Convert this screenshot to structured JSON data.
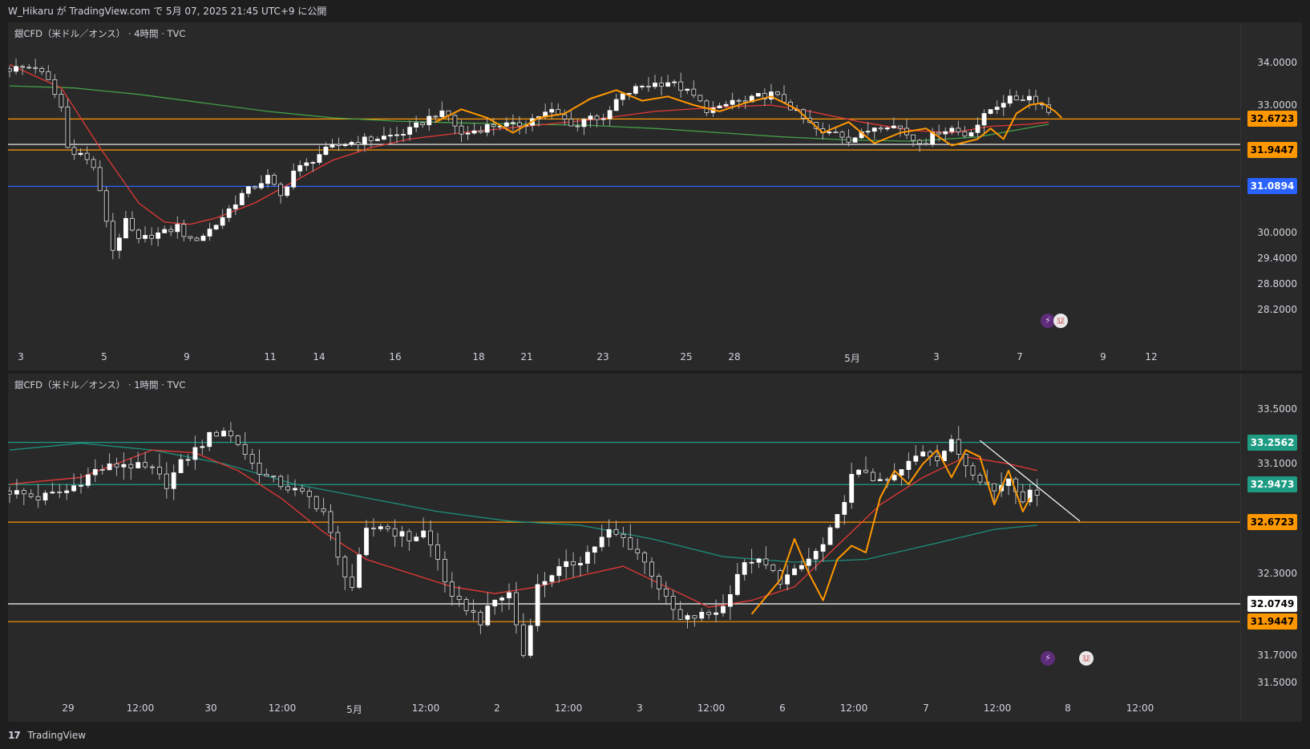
{
  "header": {
    "text": "W_Hikaru が TradingView.com で 5月 07, 2025 21:45 UTC+9 に公開"
  },
  "footer": {
    "brand": "TradingView",
    "logo_icon": "tradingview-logo-icon"
  },
  "colors": {
    "bg": "#292929",
    "up": "#ffffff",
    "down": "#1f1f1f",
    "wick": "#b2b5be",
    "ma_red": "#e53935",
    "ma_green": "#43a047",
    "ma_teal": "#1d8f7a",
    "zigzag": "#ff9800",
    "orange_level": "#ff9800",
    "blue_level": "#2962ff",
    "teal_level": "#1e9c83",
    "white_level": "#ffffff"
  },
  "chart_data": [
    {
      "type": "candlestick",
      "title": "銀CFD（米ドル／オンス） · 4時間 · TVC",
      "y_ticks": [
        "34.0000",
        "33.0000",
        "30.0000",
        "29.4000",
        "28.8000",
        "28.2000"
      ],
      "ylim": [
        27.5,
        34.6
      ],
      "x_ticks": [
        "3",
        "5",
        "9",
        "11",
        "14",
        "16",
        "18",
        "21",
        "23",
        "25",
        "28",
        "5月",
        "3",
        "7",
        "9",
        "12"
      ],
      "price_tags": [
        {
          "value": 32.6723,
          "label": "32.6723",
          "color": "orange"
        },
        {
          "value": 31.9447,
          "label": "31.9447",
          "color": "orange"
        },
        {
          "value": 31.0894,
          "label": "31.0894",
          "color": "blue"
        },
        {
          "value": 32.0749,
          "label": "32.0749",
          "color": "white",
          "hidden": true
        }
      ],
      "levels": [
        32.6723,
        32.0749,
        31.9447,
        31.0894
      ],
      "close_path": [
        [
          0,
          33.85
        ],
        [
          4,
          33.9
        ],
        [
          6,
          33.55
        ],
        [
          8,
          32.95
        ],
        [
          9,
          32.0
        ],
        [
          11,
          31.85
        ],
        [
          13,
          31.55
        ],
        [
          15,
          30.3
        ],
        [
          16,
          29.6
        ],
        [
          18,
          30.25
        ],
        [
          20,
          29.8
        ],
        [
          22,
          29.95
        ],
        [
          24,
          30.0
        ],
        [
          26,
          30.15
        ],
        [
          28,
          29.8
        ],
        [
          30,
          29.95
        ],
        [
          32,
          30.2
        ],
        [
          34,
          30.55
        ],
        [
          36,
          30.9
        ],
        [
          38,
          31.1
        ],
        [
          40,
          31.3
        ],
        [
          42,
          30.85
        ],
        [
          44,
          31.45
        ],
        [
          46,
          31.6
        ],
        [
          48,
          31.85
        ],
        [
          50,
          32.0
        ],
        [
          52,
          32.1
        ],
        [
          54,
          32.15
        ],
        [
          56,
          32.2
        ],
        [
          58,
          32.25
        ],
        [
          60,
          32.3
        ],
        [
          62,
          32.4
        ],
        [
          64,
          32.6
        ],
        [
          66,
          32.8
        ],
        [
          68,
          32.75
        ],
        [
          70,
          32.3
        ],
        [
          72,
          32.4
        ],
        [
          74,
          32.5
        ],
        [
          76,
          32.55
        ],
        [
          78,
          32.5
        ],
        [
          80,
          32.6
        ],
        [
          82,
          32.75
        ],
        [
          84,
          32.85
        ],
        [
          86,
          32.65
        ],
        [
          88,
          32.5
        ],
        [
          90,
          32.8
        ],
        [
          92,
          32.6
        ],
        [
          94,
          33.1
        ],
        [
          96,
          33.3
        ],
        [
          98,
          33.45
        ],
        [
          100,
          33.5
        ],
        [
          102,
          33.55
        ],
        [
          104,
          33.4
        ],
        [
          106,
          33.2
        ],
        [
          108,
          32.9
        ],
        [
          110,
          32.9
        ],
        [
          112,
          33.1
        ],
        [
          114,
          33.05
        ],
        [
          116,
          33.2
        ],
        [
          118,
          33.25
        ],
        [
          120,
          33.1
        ],
        [
          122,
          32.8
        ],
        [
          124,
          32.55
        ],
        [
          126,
          32.3
        ],
        [
          128,
          32.4
        ],
        [
          130,
          32.2
        ],
        [
          132,
          32.3
        ],
        [
          134,
          32.5
        ],
        [
          136,
          32.55
        ],
        [
          138,
          32.45
        ],
        [
          140,
          32.2
        ],
        [
          142,
          32.15
        ],
        [
          144,
          32.4
        ],
        [
          146,
          32.45
        ],
        [
          148,
          32.3
        ],
        [
          150,
          32.55
        ],
        [
          152,
          32.9
        ],
        [
          154,
          33.1
        ],
        [
          156,
          33.15
        ],
        [
          158,
          33.2
        ],
        [
          160,
          33.0
        ],
        [
          161,
          32.85
        ]
      ],
      "ma_fast": [
        [
          0,
          33.95
        ],
        [
          8,
          33.4
        ],
        [
          14,
          32.0
        ],
        [
          20,
          30.7
        ],
        [
          24,
          30.25
        ],
        [
          28,
          30.2
        ],
        [
          32,
          30.35
        ],
        [
          38,
          30.7
        ],
        [
          44,
          31.2
        ],
        [
          50,
          31.7
        ],
        [
          56,
          32.0
        ],
        [
          62,
          32.2
        ],
        [
          70,
          32.35
        ],
        [
          80,
          32.5
        ],
        [
          90,
          32.65
        ],
        [
          100,
          32.85
        ],
        [
          110,
          32.95
        ],
        [
          118,
          33.0
        ],
        [
          124,
          32.85
        ],
        [
          132,
          32.6
        ],
        [
          140,
          32.4
        ],
        [
          146,
          32.35
        ],
        [
          152,
          32.5
        ],
        [
          158,
          32.55
        ],
        [
          161,
          32.6
        ]
      ],
      "ma_slow": [
        [
          0,
          33.45
        ],
        [
          10,
          33.4
        ],
        [
          20,
          33.25
        ],
        [
          30,
          33.05
        ],
        [
          40,
          32.85
        ],
        [
          50,
          32.7
        ],
        [
          60,
          32.62
        ],
        [
          70,
          32.58
        ],
        [
          80,
          32.55
        ],
        [
          90,
          32.52
        ],
        [
          100,
          32.45
        ],
        [
          110,
          32.35
        ],
        [
          120,
          32.25
        ],
        [
          130,
          32.18
        ],
        [
          140,
          32.15
        ],
        [
          150,
          32.25
        ],
        [
          161,
          32.55
        ]
      ],
      "zigzag": [
        [
          66,
          32.6
        ],
        [
          70,
          32.9
        ],
        [
          74,
          32.7
        ],
        [
          78,
          32.35
        ],
        [
          82,
          32.7
        ],
        [
          86,
          32.8
        ],
        [
          90,
          33.15
        ],
        [
          94,
          33.35
        ],
        [
          98,
          33.1
        ],
        [
          102,
          33.2
        ],
        [
          106,
          33.0
        ],
        [
          110,
          32.85
        ],
        [
          114,
          33.05
        ],
        [
          118,
          33.2
        ],
        [
          122,
          32.9
        ],
        [
          126,
          32.35
        ],
        [
          130,
          32.6
        ],
        [
          134,
          32.1
        ],
        [
          138,
          32.35
        ],
        [
          142,
          32.45
        ],
        [
          146,
          32.05
        ],
        [
          150,
          32.2
        ],
        [
          152,
          32.45
        ],
        [
          154,
          32.2
        ],
        [
          156,
          32.8
        ],
        [
          158,
          33.0
        ],
        [
          160,
          33.05
        ],
        [
          162,
          32.85
        ],
        [
          163,
          32.7
        ]
      ]
    },
    {
      "type": "candlestick",
      "title": "銀CFD（米ドル／オンス） · 1時間 · TVC",
      "y_ticks": [
        "33.5000",
        "33.1000",
        "32.3000",
        "31.7000",
        "31.5000"
      ],
      "ylim": [
        31.4,
        33.7
      ],
      "x_ticks": [
        "29",
        "12:00",
        "30",
        "12:00",
        "5月",
        "12:00",
        "2",
        "12:00",
        "3",
        "12:00",
        "6",
        "12:00",
        "7",
        "12:00",
        "8",
        "12:00"
      ],
      "price_tags": [
        {
          "value": 33.2562,
          "label": "33.2562",
          "color": "teal"
        },
        {
          "value": 32.9473,
          "label": "32.9473",
          "color": "teal"
        },
        {
          "value": 32.6723,
          "label": "32.6723",
          "color": "orange"
        },
        {
          "value": 32.0749,
          "label": "32.0749",
          "color": "white"
        },
        {
          "value": 31.9447,
          "label": "31.9447",
          "color": "orange"
        }
      ],
      "levels": [
        33.2562,
        32.9473,
        32.6723,
        32.0749,
        31.9447
      ],
      "close_path": [
        [
          0,
          32.9
        ],
        [
          4,
          32.85
        ],
        [
          8,
          32.9
        ],
        [
          12,
          33.05
        ],
        [
          16,
          33.1
        ],
        [
          20,
          33.05
        ],
        [
          22,
          32.95
        ],
        [
          24,
          33.1
        ],
        [
          26,
          33.2
        ],
        [
          28,
          33.3
        ],
        [
          30,
          33.35
        ],
        [
          32,
          33.25
        ],
        [
          34,
          33.1
        ],
        [
          36,
          33.0
        ],
        [
          38,
          32.95
        ],
        [
          40,
          32.9
        ],
        [
          42,
          32.85
        ],
        [
          44,
          32.75
        ],
        [
          46,
          32.4
        ],
        [
          48,
          32.2
        ],
        [
          50,
          32.6
        ],
        [
          52,
          32.65
        ],
        [
          54,
          32.6
        ],
        [
          56,
          32.55
        ],
        [
          58,
          32.6
        ],
        [
          60,
          32.4
        ],
        [
          62,
          32.1
        ],
        [
          64,
          32.05
        ],
        [
          66,
          31.95
        ],
        [
          68,
          32.1
        ],
        [
          70,
          32.15
        ],
        [
          72,
          31.7
        ],
        [
          74,
          32.2
        ],
        [
          76,
          32.3
        ],
        [
          78,
          32.35
        ],
        [
          80,
          32.4
        ],
        [
          82,
          32.5
        ],
        [
          84,
          32.6
        ],
        [
          86,
          32.55
        ],
        [
          88,
          32.45
        ],
        [
          90,
          32.3
        ],
        [
          92,
          32.1
        ],
        [
          94,
          31.95
        ],
        [
          96,
          31.98
        ],
        [
          98,
          32.0
        ],
        [
          100,
          32.05
        ],
        [
          102,
          32.3
        ],
        [
          104,
          32.4
        ],
        [
          106,
          32.35
        ],
        [
          108,
          32.25
        ],
        [
          110,
          32.3
        ],
        [
          112,
          32.4
        ],
        [
          114,
          32.5
        ],
        [
          116,
          32.7
        ],
        [
          118,
          33.0
        ],
        [
          120,
          33.05
        ],
        [
          122,
          32.95
        ],
        [
          124,
          33.0
        ],
        [
          126,
          33.1
        ],
        [
          128,
          33.2
        ],
        [
          130,
          33.15
        ],
        [
          132,
          33.25
        ],
        [
          134,
          33.1
        ],
        [
          136,
          33.0
        ],
        [
          138,
          32.9
        ],
        [
          140,
          33.0
        ],
        [
          142,
          32.85
        ],
        [
          144,
          32.9
        ]
      ],
      "ma_fast": [
        [
          0,
          32.95
        ],
        [
          10,
          33.0
        ],
        [
          20,
          33.2
        ],
        [
          26,
          33.18
        ],
        [
          32,
          33.05
        ],
        [
          38,
          32.85
        ],
        [
          44,
          32.6
        ],
        [
          50,
          32.4
        ],
        [
          56,
          32.3
        ],
        [
          62,
          32.2
        ],
        [
          68,
          32.15
        ],
        [
          74,
          32.2
        ],
        [
          80,
          32.28
        ],
        [
          86,
          32.35
        ],
        [
          92,
          32.2
        ],
        [
          98,
          32.05
        ],
        [
          104,
          32.1
        ],
        [
          110,
          32.2
        ],
        [
          116,
          32.5
        ],
        [
          122,
          32.8
        ],
        [
          128,
          33.0
        ],
        [
          134,
          33.15
        ],
        [
          140,
          33.1
        ],
        [
          144,
          33.05
        ]
      ],
      "ma_slow": [
        [
          0,
          33.2
        ],
        [
          10,
          33.25
        ],
        [
          20,
          33.2
        ],
        [
          30,
          33.1
        ],
        [
          40,
          32.95
        ],
        [
          50,
          32.85
        ],
        [
          60,
          32.75
        ],
        [
          70,
          32.68
        ],
        [
          80,
          32.65
        ],
        [
          90,
          32.55
        ],
        [
          100,
          32.42
        ],
        [
          110,
          32.38
        ],
        [
          120,
          32.4
        ],
        [
          130,
          32.52
        ],
        [
          138,
          32.62
        ],
        [
          144,
          32.65
        ]
      ],
      "zigzag": [
        [
          104,
          32.0
        ],
        [
          108,
          32.25
        ],
        [
          110,
          32.55
        ],
        [
          112,
          32.3
        ],
        [
          114,
          32.1
        ],
        [
          116,
          32.4
        ],
        [
          118,
          32.5
        ],
        [
          120,
          32.45
        ],
        [
          122,
          32.85
        ],
        [
          124,
          33.05
        ],
        [
          126,
          32.95
        ],
        [
          128,
          33.1
        ],
        [
          130,
          33.2
        ],
        [
          132,
          33.0
        ],
        [
          134,
          33.2
        ],
        [
          136,
          33.15
        ],
        [
          138,
          32.8
        ],
        [
          140,
          33.05
        ],
        [
          142,
          32.75
        ],
        [
          143,
          32.85
        ]
      ],
      "trendline": [
        [
          136,
          33.27
        ],
        [
          150,
          32.68
        ]
      ]
    }
  ]
}
